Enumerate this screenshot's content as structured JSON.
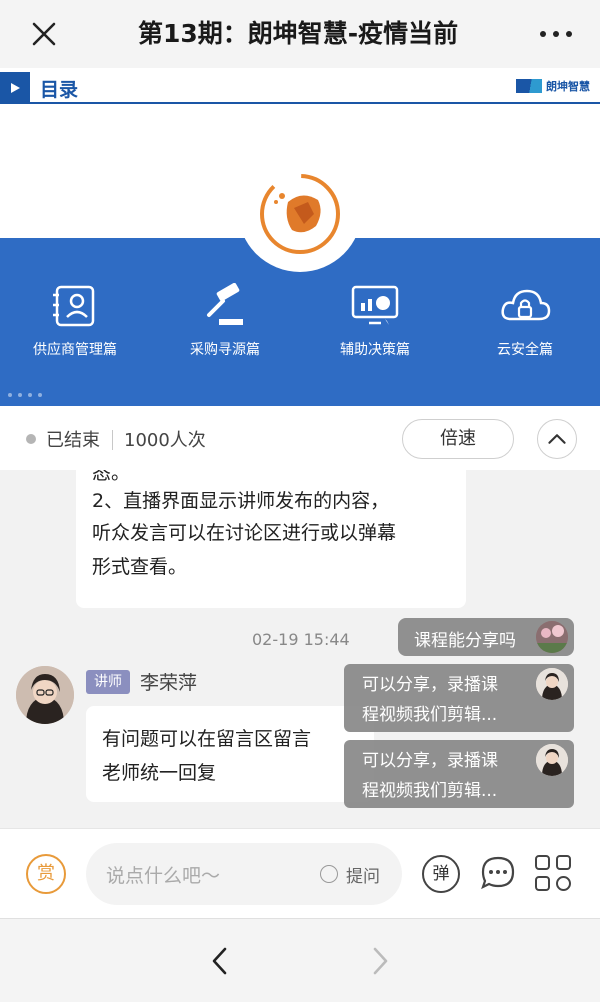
{
  "header": {
    "title": "第13期：朗坤智慧-疫情当前",
    "close_icon": "close-icon",
    "more_icon": "more-dots-icon"
  },
  "video": {
    "toc_label": "目录",
    "brand_text": "朗坤智慧",
    "features": [
      {
        "label": "供应商管理篇",
        "icon": "contact-book-icon"
      },
      {
        "label": "采购寻源篇",
        "icon": "gavel-icon"
      },
      {
        "label": "辅助决策篇",
        "icon": "chart-monitor-icon"
      },
      {
        "label": "云安全篇",
        "icon": "cloud-lock-icon"
      }
    ],
    "colors": {
      "band": "#2f6cc4",
      "accent": "#1a56a6",
      "logo_orange": "#e8862e"
    }
  },
  "status": {
    "state": "已结束",
    "viewers": "1000人次",
    "speed_label": "倍速"
  },
  "chat": {
    "message1_lines": [
      "态。",
      "2、直播界面显示讲师发布的内容，",
      "听众发言可以在讨论区进行或以弹幕",
      "形式查看。"
    ],
    "timestamp": "02-19 15:44",
    "sender_role": "讲师",
    "sender_name": "李荣萍",
    "message2_lines": [
      "有问题可以在留言区留言",
      "老师统一回复"
    ],
    "danmaku": [
      {
        "lines": [
          "课程能分享吗"
        ]
      },
      {
        "lines": [
          "可以分享，录播课",
          "程视频我们剪辑..."
        ]
      },
      {
        "lines": [
          "可以分享，录播课",
          "程视频我们剪辑..."
        ]
      }
    ]
  },
  "input": {
    "reward_label": "赏",
    "placeholder": "说点什么吧～",
    "question_label": "提问",
    "danmaku_label": "弹"
  },
  "nav": {
    "back_icon": "chevron-left-icon",
    "forward_icon": "chevron-right-icon"
  }
}
